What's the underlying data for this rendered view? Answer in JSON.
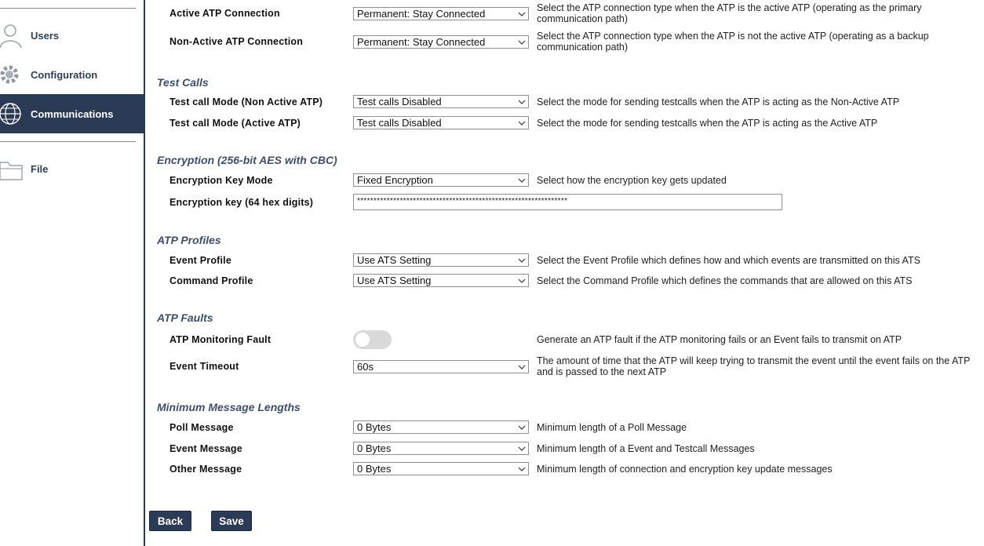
{
  "sidebar": {
    "items": [
      {
        "label": "Users",
        "icon": "user-icon"
      },
      {
        "label": "Configuration",
        "icon": "gear-icon"
      },
      {
        "label": "Communications",
        "icon": "globe-icon",
        "active": true
      },
      {
        "label": "File",
        "icon": "folder-icon"
      }
    ]
  },
  "connection": {
    "active_label": "Active ATP Connection",
    "active_value": "Permanent: Stay Connected",
    "active_desc": "Select the ATP connection type when the ATP is the active ATP (operating as the primary communication path)",
    "nonactive_label": "Non-Active ATP Connection",
    "nonactive_value": "Permanent: Stay Connected",
    "nonactive_desc": "Select the ATP connection type when the ATP is not the active ATP (operating as a backup communication path)"
  },
  "test_calls": {
    "title": "Test Calls",
    "nonactive_label": "Test call Mode (Non Active ATP)",
    "nonactive_value": "Test calls Disabled",
    "nonactive_desc": "Select the mode for sending testcalls when the ATP is acting as the Non-Active ATP",
    "active_label": "Test call Mode (Active ATP)",
    "active_value": "Test calls Disabled",
    "active_desc": "Select the mode for sending testcalls when the ATP is acting as the Active ATP"
  },
  "encryption": {
    "title": "Encryption (256-bit AES with CBC)",
    "mode_label": "Encryption Key Mode",
    "mode_value": "Fixed Encryption",
    "mode_desc": "Select how the encryption key gets updated",
    "key_label": "Encryption key (64 hex digits)",
    "key_value": "****************************************************************"
  },
  "profiles": {
    "title": "ATP Profiles",
    "event_label": "Event Profile",
    "event_value": "Use ATS Setting",
    "event_desc": "Select the Event Profile which defines how and which events are transmitted on this ATS",
    "command_label": "Command Profile",
    "command_value": "Use ATS Setting",
    "command_desc": "Select the Command Profile which defines the commands that are allowed on this ATS"
  },
  "faults": {
    "title": "ATP Faults",
    "monitoring_label": "ATP Monitoring Fault",
    "monitoring_enabled": false,
    "monitoring_desc": "Generate an ATP fault if the ATP monitoring fails or an Event fails to transmit on ATP",
    "timeout_label": "Event Timeout",
    "timeout_value": "60s",
    "timeout_desc": "The amount of time that the ATP will keep trying to transmit the event until the event fails on the ATP and is passed to the next ATP"
  },
  "message_lengths": {
    "title": "Minimum Message Lengths",
    "poll_label": "Poll Message",
    "poll_value": "0 Bytes",
    "poll_desc": "Minimum length of a Poll Message",
    "event_label": "Event Message",
    "event_value": "0 Bytes",
    "event_desc": "Minimum length of a Event and Testcall Messages",
    "other_label": "Other Message",
    "other_value": "0 Bytes",
    "other_desc": "Minimum length of connection and encryption key update messages"
  },
  "buttons": {
    "back": "Back",
    "save": "Save"
  },
  "colors": {
    "nav_active": "#2b3a55",
    "section_title": "#3b4f6e",
    "button": "#2b3a55"
  }
}
